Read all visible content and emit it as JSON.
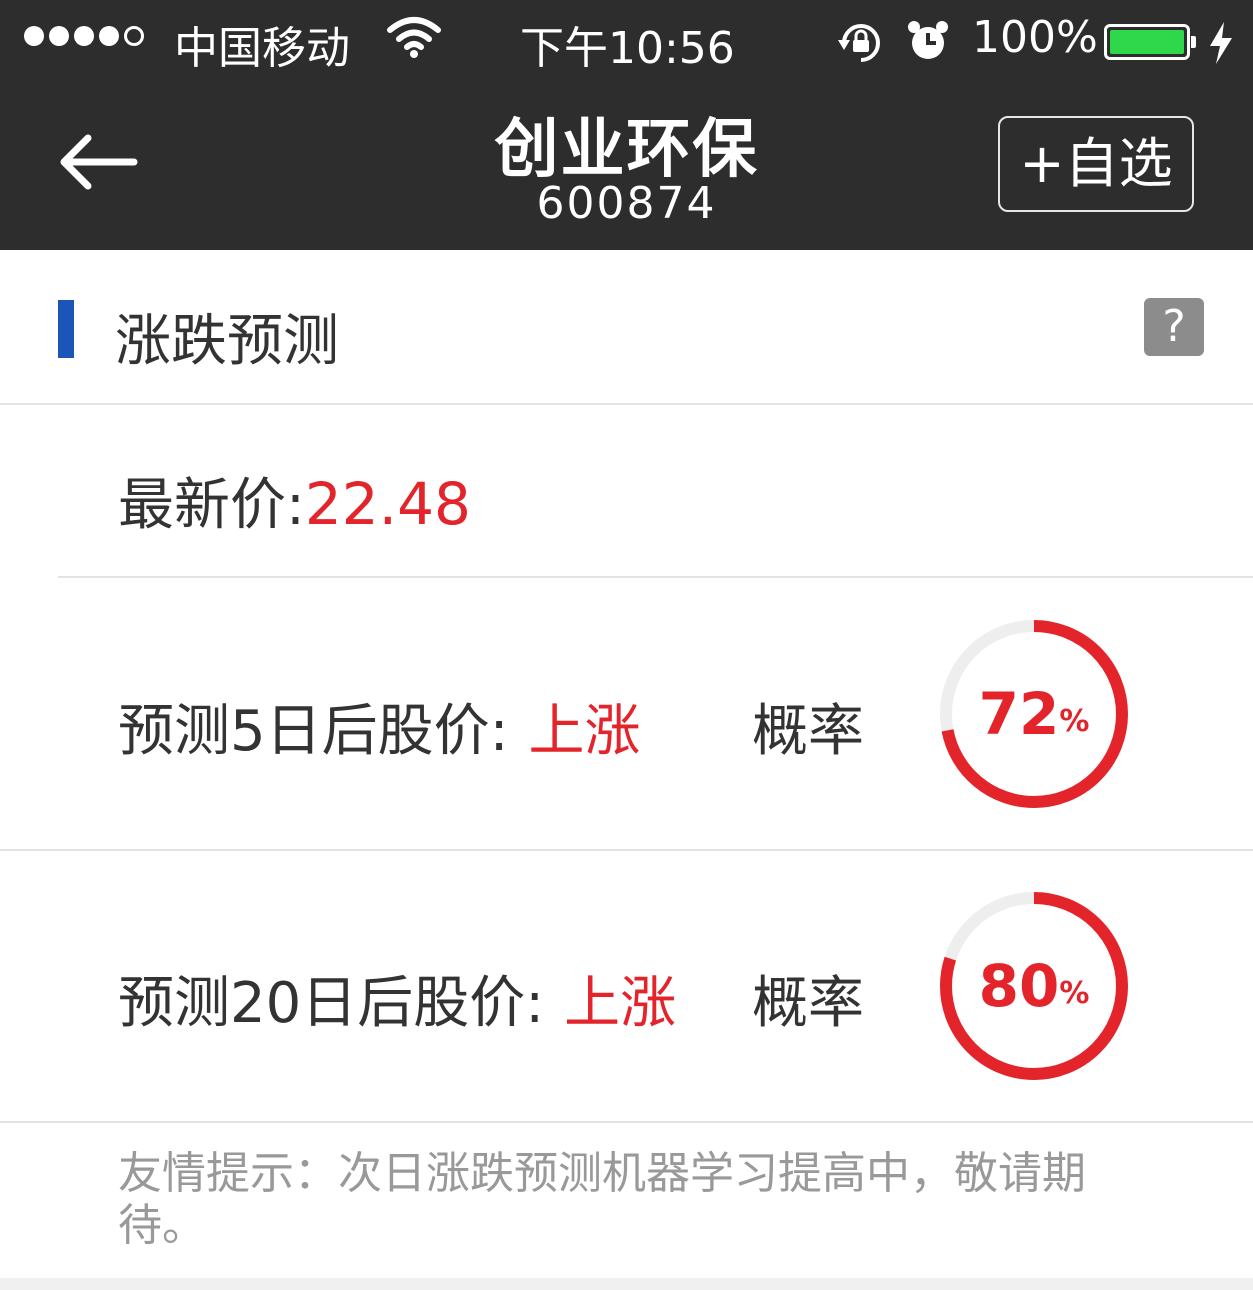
{
  "status_bar": {
    "carrier": "中国移动",
    "time": "下午10:56",
    "battery": "100%",
    "battery_level": 1.0,
    "signal_bars_filled": 4,
    "signal_bars_total": 5
  },
  "nav": {
    "title": "创业环保",
    "code": "600874",
    "add_label": "+自选"
  },
  "section": {
    "title": "涨跌预测",
    "help_label": "?",
    "accent_color": "#1b55b8"
  },
  "price": {
    "label": "最新价:",
    "value": "22.48"
  },
  "predictions": [
    {
      "label": "预测5日后股价:",
      "direction": "上涨",
      "prob_label": "概率",
      "probability": 72,
      "percent_sign": "%"
    },
    {
      "label": "预测20日后股价:",
      "direction": "上涨",
      "prob_label": "概率",
      "probability": 80,
      "percent_sign": "%"
    }
  ],
  "tip": "友情提示：次日涨跌预测机器学习提高中，敬请期待。",
  "colors": {
    "up_red": "#e3242b",
    "gauge_track": "#eeeeee",
    "topbar": "#2d2d2d",
    "battery_green": "#2fd84a"
  }
}
